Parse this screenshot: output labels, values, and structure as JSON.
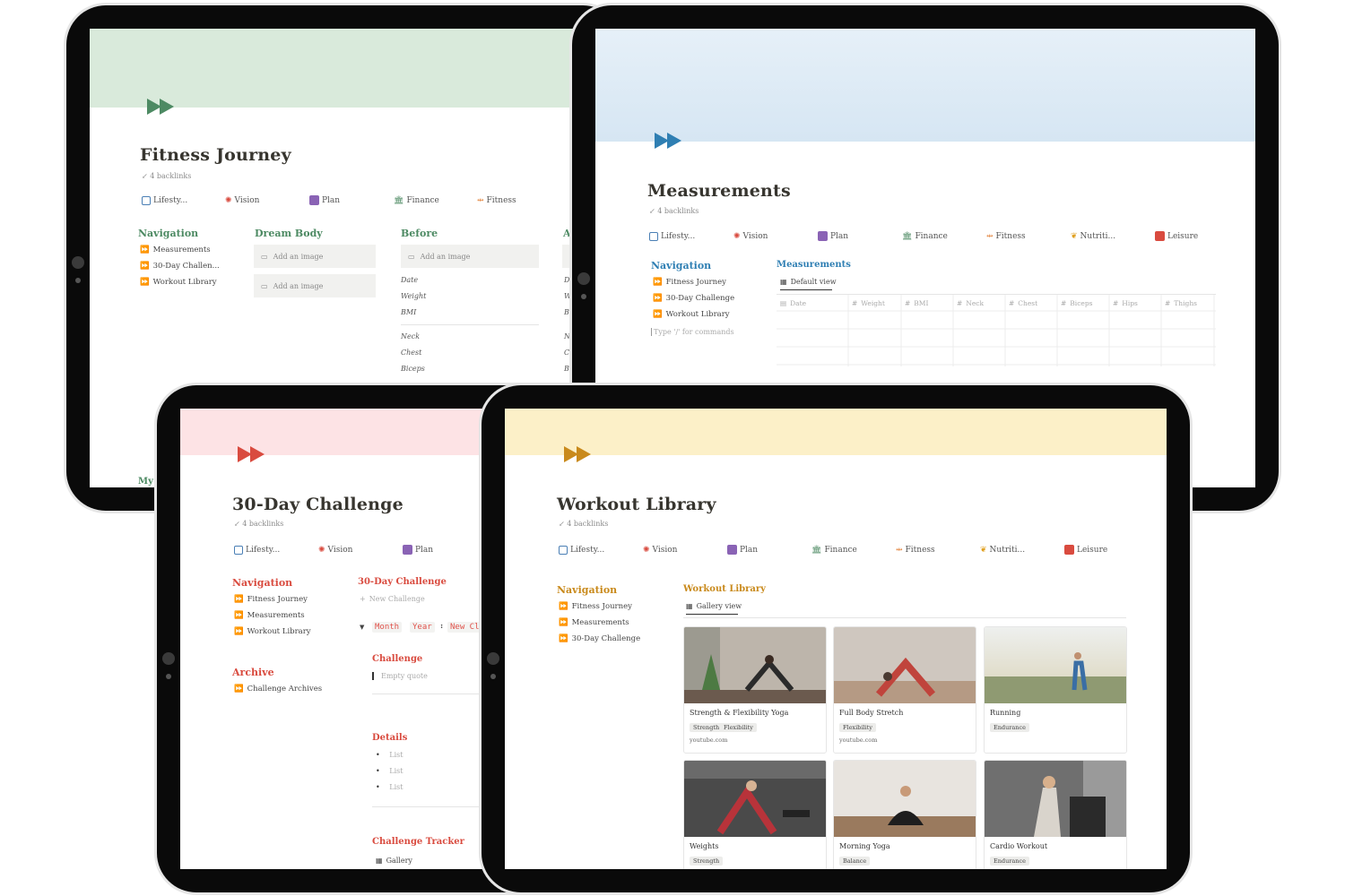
{
  "colors": {
    "green": "#4d8a63",
    "blue": "#2f7fb3",
    "red": "#d94b3f",
    "gold": "#c98a1c",
    "cover_green": "#d9eadb",
    "cover_blue": "#dde9f4",
    "cover_red": "#fde3e5",
    "cover_gold": "#fcf0c8"
  },
  "icons": {
    "forward": "fast-forward-icon",
    "image": "image-icon",
    "gallery": "gallery-icon",
    "table": "table-icon"
  },
  "chips": {
    "lifestyle": "Lifesty...",
    "vision": "Vision",
    "plan": "Plan",
    "finance": "Finance",
    "fitness": "Fitness",
    "nutrition": "Nutriti...",
    "leisure": "Leisure"
  },
  "backlinks": "4 backlinks",
  "nav_heading": "Navigation",
  "fitness_journey": {
    "title": "Fitness Journey",
    "nav": [
      "Measurements",
      "30-Day Challen...",
      "Workout Library"
    ],
    "dream_body": "Dream Body",
    "before": "Before",
    "add_image": "Add an image",
    "fields": [
      "Date",
      "Weight",
      "BMI",
      "Neck",
      "Chest",
      "Biceps"
    ],
    "col_a_initial": "A",
    "col_a_letters": [
      "D",
      "W",
      "B",
      "N",
      "C",
      "B"
    ],
    "bottom_label": "My"
  },
  "measurements": {
    "title": "Measurements",
    "nav": [
      "Fitness Journey",
      "30-Day Challenge",
      "Workout Library"
    ],
    "type_hint": "Type '/' for commands",
    "db_title": "Measurements",
    "view": "Default view",
    "columns": [
      "Date",
      "Weight",
      "BMI",
      "Neck",
      "Chest",
      "Biceps",
      "Hips",
      "Thighs"
    ]
  },
  "challenge": {
    "title": "30-Day Challenge",
    "nav": [
      "Fitness Journey",
      "Measurements",
      "Workout Library"
    ],
    "archive_heading": "Archive",
    "archive_item": "Challenge Archives",
    "db_title": "30-Day Challenge",
    "new_challenge": "New Challenge",
    "props": [
      "Month",
      "Year",
      "New Cl"
    ],
    "challenge_heading": "Challenge",
    "empty_quote": "Empty quote",
    "details_heading": "Details",
    "list_items": [
      "List",
      "List",
      "List"
    ],
    "tracker_heading": "Challenge Tracker",
    "tracker_view": "Gallery"
  },
  "library": {
    "title": "Workout Library",
    "nav": [
      "Fitness Journey",
      "Measurements",
      "30-Day Challenge"
    ],
    "db_title": "Workout Library",
    "view": "Gallery view",
    "cards": [
      {
        "name": "Strength & Flexibility Yoga",
        "tags": [
          "Strength",
          "Flexibility"
        ],
        "source": "youtube.com"
      },
      {
        "name": "Full Body Stretch",
        "tags": [
          "Flexibility"
        ],
        "source": "youtube.com"
      },
      {
        "name": "Running",
        "tags": [
          "Endurance"
        ],
        "source": ""
      },
      {
        "name": "Weights",
        "tags": [
          "Strength"
        ],
        "source": ""
      },
      {
        "name": "Morning Yoga",
        "tags": [
          "Balance"
        ],
        "source": ""
      },
      {
        "name": "Cardio Workout",
        "tags": [
          "Endurance"
        ],
        "source": ""
      }
    ]
  }
}
